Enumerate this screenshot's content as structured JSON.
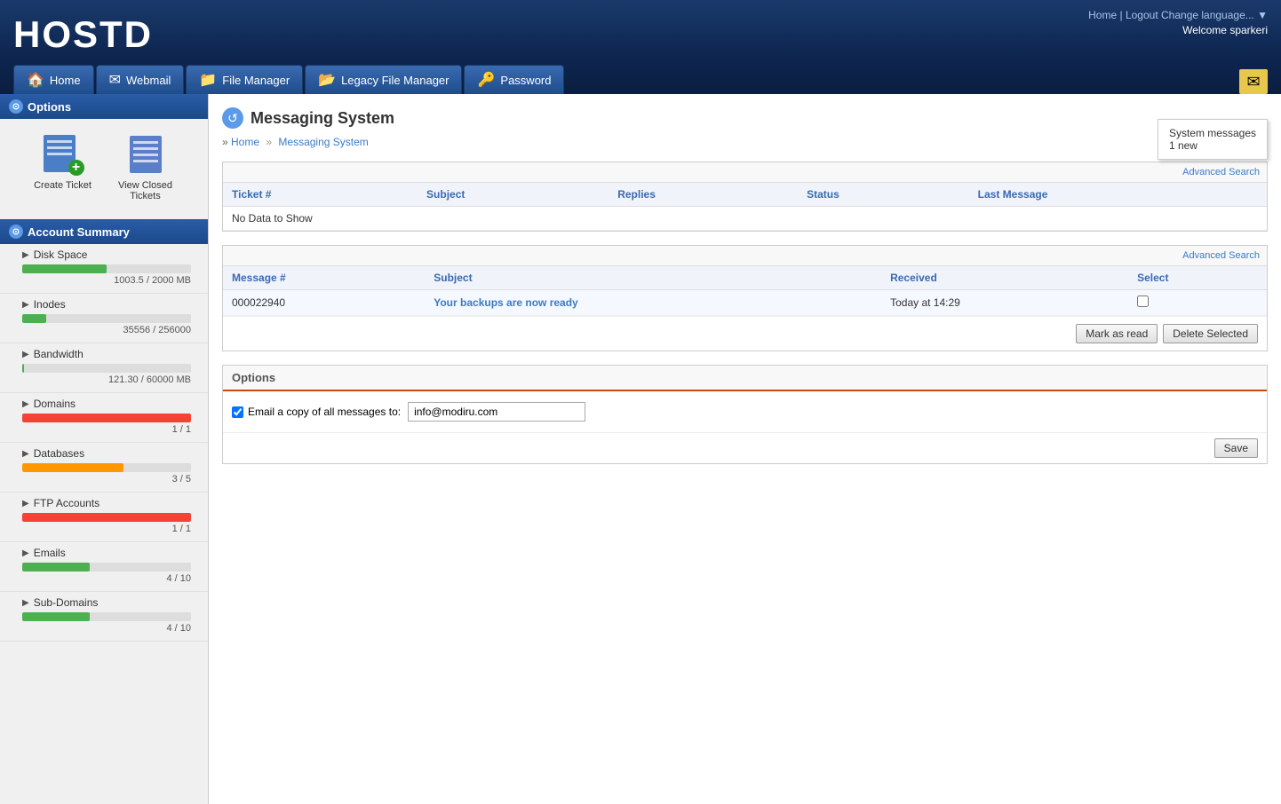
{
  "header": {
    "logo": "HOSTD",
    "nav_links": {
      "home": "Home",
      "logout": "Logout",
      "change_language": "Change language..."
    },
    "welcome_label": "Welcome",
    "username": "sparkeri",
    "tabs": [
      {
        "label": "Home",
        "icon": "🏠"
      },
      {
        "label": "Webmail",
        "icon": "✉"
      },
      {
        "label": "File Manager",
        "icon": "📁"
      },
      {
        "label": "Legacy File Manager",
        "icon": "📂"
      },
      {
        "label": "Password",
        "icon": "🔑"
      }
    ],
    "mail_button_icon": "✉",
    "tooltip": {
      "line1": "System messages",
      "line2": "1 new"
    }
  },
  "sidebar": {
    "options_header": "Options",
    "create_ticket_label": "Create Ticket",
    "view_closed_label": "View Closed\nTickets",
    "account_header": "Account Summary",
    "resources": [
      {
        "name": "Disk Space",
        "used": 1003.5,
        "total": 2000,
        "label": "1003.5 / 2000 MB",
        "pct": 50,
        "color": "green"
      },
      {
        "name": "Inodes",
        "used": 35556,
        "total": 256000,
        "label": "35556 / 256000",
        "pct": 14,
        "color": "green"
      },
      {
        "name": "Bandwidth",
        "used": 121.3,
        "total": 60000,
        "label": "121.30 / 60000 MB",
        "pct": 1,
        "color": "green"
      },
      {
        "name": "Domains",
        "used": 1,
        "total": 1,
        "label": "1 / 1",
        "pct": 100,
        "color": "red"
      },
      {
        "name": "Databases",
        "used": 3,
        "total": 5,
        "label": "3 / 5",
        "pct": 60,
        "color": "orange"
      },
      {
        "name": "FTP Accounts",
        "used": 1,
        "total": 1,
        "label": "1 / 1",
        "pct": 100,
        "color": "red"
      },
      {
        "name": "Emails",
        "used": 4,
        "total": 10,
        "label": "4 / 10",
        "pct": 40,
        "color": "green"
      },
      {
        "name": "Sub-Domains",
        "used": 4,
        "total": 10,
        "label": "4 / 10",
        "pct": 40,
        "color": "green"
      }
    ]
  },
  "content": {
    "page_title": "Messaging System",
    "breadcrumb_home": "Home",
    "breadcrumb_current": "Messaging System",
    "advanced_search_label": "Advanced Search",
    "tickets_table": {
      "headers": [
        "Ticket #",
        "Subject",
        "Replies",
        "Status",
        "Last Message"
      ],
      "no_data": "No Data to Show"
    },
    "messages_table": {
      "advanced_search_label": "Advanced Search",
      "headers": [
        "Message #",
        "Subject",
        "Received",
        "Select"
      ],
      "rows": [
        {
          "id": "000022940",
          "subject": "Your backups are now ready",
          "received": "Today at 14:29",
          "selected": false
        }
      ]
    },
    "mark_as_read_btn": "Mark as read",
    "delete_selected_btn": "Delete Selected",
    "options_panel": {
      "title": "Options",
      "email_copy_label": "Email a copy of all messages to:",
      "email_value": "info@modiru.com",
      "email_checked": true,
      "save_btn": "Save"
    }
  }
}
